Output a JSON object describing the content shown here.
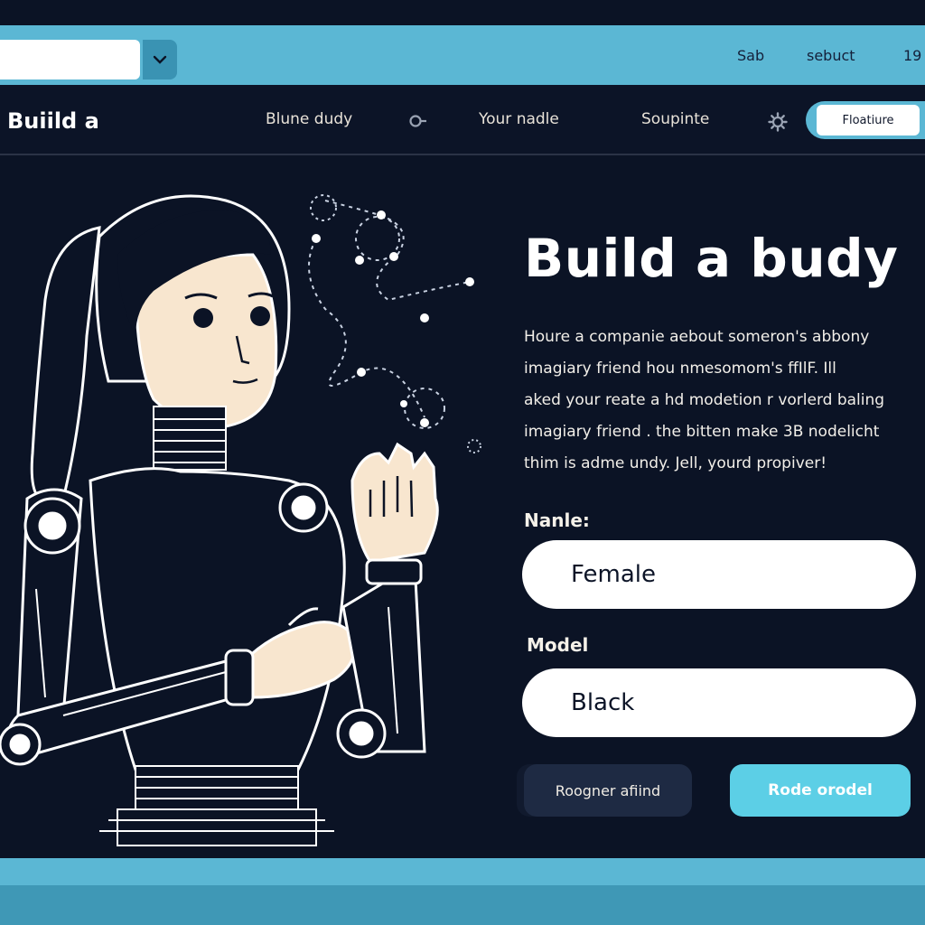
{
  "topbar": {
    "address_value": "",
    "links": [
      "Sab",
      "sebuct",
      "19"
    ]
  },
  "navbar": {
    "brand": "Buiild a",
    "links": [
      "Blune dudy",
      "Your nadle",
      "Soupinte"
    ],
    "button": "Floatiure"
  },
  "hero": {
    "title": "Build a budy",
    "description": "Houre a companie aebout someron's abbony\nimagiary friend hou nmesomom's ffIlF. Ill\naked your reate a hd modetion r vorlerd baling\nimagiary friend . the bitten make 3B nodelicht\nthim is adme undy.  Jell, yourd propiver!"
  },
  "form": {
    "name_label": "Nanle:",
    "name_value": "Female",
    "model_label": "Model",
    "model_value": "Black"
  },
  "actions": {
    "secondary": "Roogner afiind",
    "primary": "Rode orodel"
  },
  "colors": {
    "background": "#0b1325",
    "accent": "#5bb7d4",
    "primary_button": "#5ccfe6"
  }
}
